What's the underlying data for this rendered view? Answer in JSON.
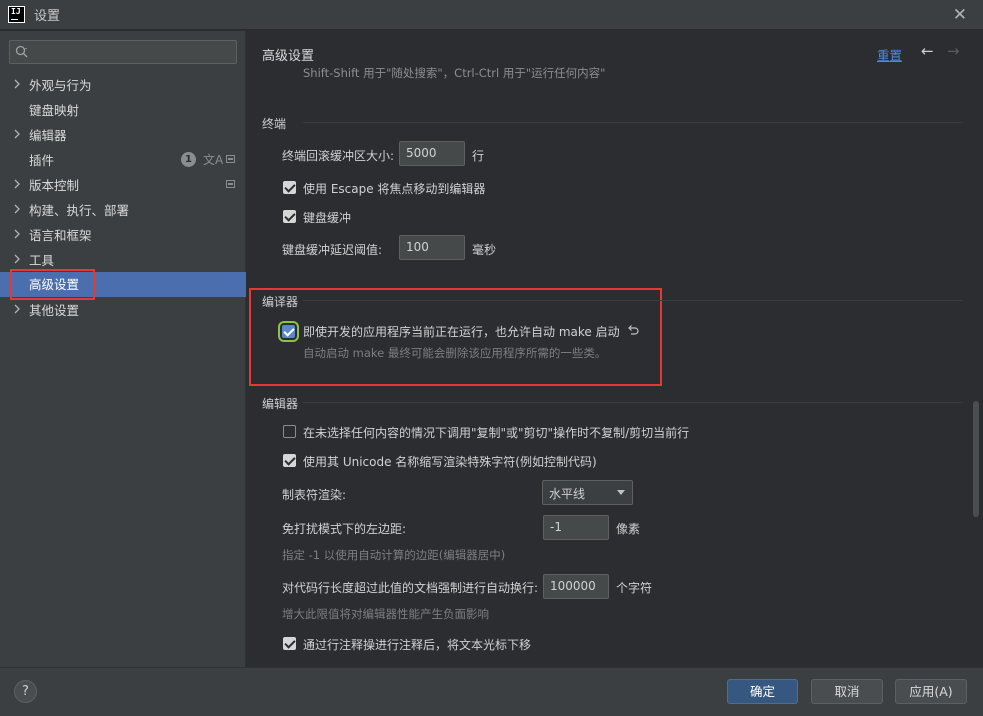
{
  "window": {
    "icon_text": "IJ",
    "title": "设置",
    "close_glyph": "✕"
  },
  "sidebar": {
    "items": [
      {
        "label": "外观与行为",
        "expandable": true
      },
      {
        "label": "键盘映射",
        "expandable": false
      },
      {
        "label": "编辑器",
        "expandable": true
      },
      {
        "label": "插件",
        "expandable": false,
        "badge": "1",
        "translate_glyph": "文A"
      },
      {
        "label": "版本控制",
        "expandable": true
      },
      {
        "label": "构建、执行、部署",
        "expandable": true
      },
      {
        "label": "语言和框架",
        "expandable": true
      },
      {
        "label": "工具",
        "expandable": true
      },
      {
        "label": "高级设置",
        "expandable": false,
        "selected": true
      },
      {
        "label": "其他设置",
        "expandable": true
      }
    ]
  },
  "header": {
    "title": "高级设置",
    "reset": "重置",
    "back_glyph": "←",
    "forward_glyph": "→"
  },
  "top_hint": "Shift-Shift 用于\"随处搜索\"，Ctrl-Ctrl 用于\"运行任何内容\"",
  "terminal": {
    "title": "终端",
    "scrollback_label": "终端回滚缓冲区大小:",
    "scrollback_value": "5000",
    "scrollback_unit": "行",
    "escape_label": "使用 Escape 将焦点移动到编辑器",
    "escape_checked": true,
    "kbd_buffer_label": "键盘缓冲",
    "kbd_buffer_checked": true,
    "kbd_delay_label": "键盘缓冲延迟阈值:",
    "kbd_delay_value": "100",
    "kbd_delay_unit": "毫秒"
  },
  "compiler": {
    "title": "编译器",
    "auto_make_label": "即使开发的应用程序当前正在运行，也允许自动 make 启动",
    "auto_make_checked": true,
    "auto_make_hint": "自动启动 make 最终可能会删除该应用程序所需的一些类。"
  },
  "editor": {
    "title": "编辑器",
    "copy_cut_label": "在未选择任何内容的情况下调用\"复制\"或\"剪切\"操作时不复制/剪切当前行",
    "copy_cut_checked": false,
    "unicode_label": "使用其 Unicode 名称缩写渲染特殊字符(例如控制代码)",
    "unicode_checked": true,
    "tab_render_label": "制表符渲染:",
    "tab_render_value": "水平线",
    "distraction_free_label": "免打扰模式下的左边距:",
    "distraction_free_value": "-1",
    "distraction_free_unit": "像素",
    "distraction_free_hint": "指定 -1 以使用自动计算的边距(编辑器居中)",
    "soft_wrap_label": "对代码行长度超过此值的文档强制进行自动换行:",
    "soft_wrap_value": "100000",
    "soft_wrap_unit": "个字符",
    "soft_wrap_hint": "增大此限值将对编辑器性能产生负面影响",
    "caret_move_label": "通过行注释操进行注释后，将文本光标下移",
    "caret_move_checked": true
  },
  "footer": {
    "help": "?",
    "ok": "确定",
    "cancel": "取消",
    "apply": "应用(A)"
  }
}
